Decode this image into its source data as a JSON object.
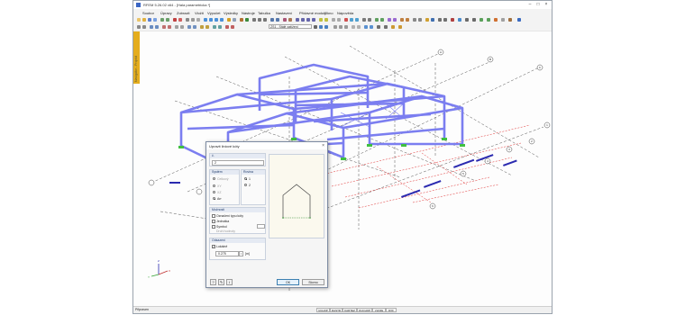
{
  "app": {
    "title": "RFEM 5.26.02 x64 - [Hala parametricka *]",
    "menu": [
      "Soubor",
      "Úpravy",
      "Zobrazit",
      "Vložit",
      "Výpočet",
      "Výsledky",
      "Nástroje",
      "Tabulka",
      "Nastavení",
      "Přídavné moduly",
      "Okno",
      "Nápověda"
    ],
    "load_case_combo": "ZS1 - Stálé zatížení",
    "side_panel_label": "Navigátor - Projekt",
    "status_ready": "Připraven",
    "status_buttons": [
      "UCHOP",
      "RASTR",
      "KARTEZ",
      "OUCHOP",
      "VLINIE",
      "DXF"
    ],
    "axis_labels": {
      "x": "X",
      "y": "Y",
      "z": "Z"
    },
    "grid_labels": [
      "A",
      "B",
      "C",
      "1",
      "2",
      "3",
      "4",
      "5",
      "6"
    ],
    "colors": {
      "member": "#7b7ef0",
      "support": "#40c040",
      "grid": "#555555",
      "grid_red": "#e03030",
      "load_blue": "#2a2ab0"
    }
  },
  "dialog": {
    "title": "Upravit liniové kóty",
    "no_header": "č.",
    "no_value": "2",
    "system_header": "Systém",
    "system_options": [
      "Celkový",
      "XY",
      "XZ",
      "Arr"
    ],
    "system_selected": 3,
    "plane_header": "Rovina",
    "plane_options": [
      "1",
      "2"
    ],
    "plane_selected": 0,
    "options_header": "Možnosti",
    "options": [
      {
        "label": "Označení typu kóty",
        "checked": false,
        "disabled": false
      },
      {
        "label": "Jednotka",
        "checked": false,
        "disabled": false
      },
      {
        "label": "Symbol",
        "checked": false,
        "disabled": false
      }
    ],
    "symbol_hint": "Druh hodnoty",
    "offset_header": "Odsazení",
    "offset_check_label": "Lokálně",
    "offset_checked": true,
    "offset_value": "0.275",
    "offset_unit": "[m]",
    "ok_label": "OK",
    "cancel_label": "Storno"
  }
}
